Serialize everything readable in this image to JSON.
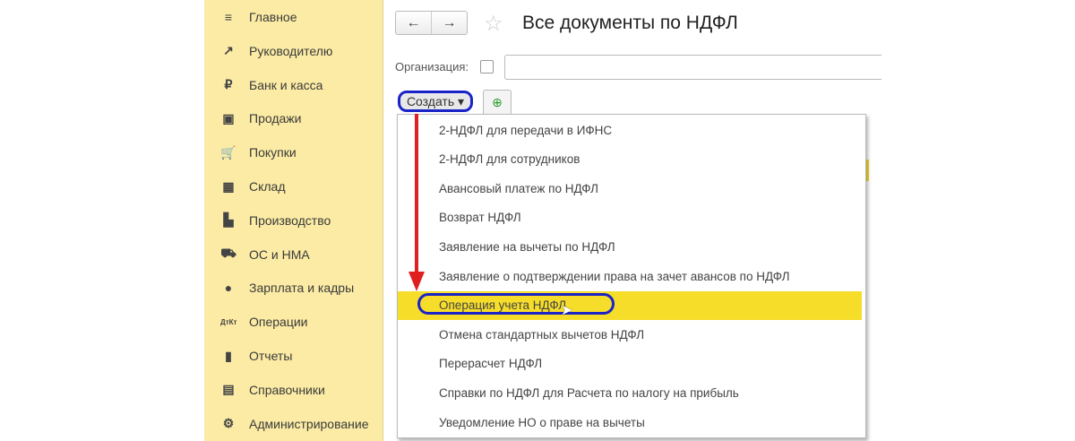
{
  "sidebar": {
    "items": [
      {
        "label": "Главное",
        "icon": "≡"
      },
      {
        "label": "Руководителю",
        "icon": "↗"
      },
      {
        "label": "Банк и касса",
        "icon": "₽"
      },
      {
        "label": "Продажи",
        "icon": "▣"
      },
      {
        "label": "Покупки",
        "icon": "🛒"
      },
      {
        "label": "Склад",
        "icon": "▦"
      },
      {
        "label": "Производство",
        "icon": "▙"
      },
      {
        "label": "ОС и НМА",
        "icon": "⛟"
      },
      {
        "label": "Зарплата и кадры",
        "icon": "●"
      },
      {
        "label": "Операции",
        "icon": "ДтКт"
      },
      {
        "label": "Отчеты",
        "icon": "▮"
      },
      {
        "label": "Справочники",
        "icon": "▤"
      },
      {
        "label": "Администрирование",
        "icon": "⚙"
      }
    ]
  },
  "header": {
    "back": "←",
    "forward": "→",
    "star": "☆",
    "title": "Все документы по НДФЛ"
  },
  "filter": {
    "org_label": "Организация:"
  },
  "toolbar": {
    "create_label": "Создать ▾",
    "add_icon": "⊕"
  },
  "menu": {
    "items": [
      "2-НДФЛ для передачи в ИФНС",
      "2-НДФЛ для сотрудников",
      "Авансовый платеж по НДФЛ",
      "Возврат НДФЛ",
      "Заявление на вычеты по НДФЛ",
      "Заявление о подтверждении права на зачет авансов по НДФЛ",
      "Операция учета НДФЛ",
      "Отмена стандартных вычетов НДФЛ",
      "Перерасчет НДФЛ",
      "Справки по НДФЛ для Расчета по налогу на прибыль",
      "Уведомление НО о праве на вычеты"
    ],
    "selected_index": 6
  },
  "colors": {
    "sidebar": "#fbeba4",
    "highlight": "#f6dd2a",
    "annotation": "#1a23c8",
    "arrow": "#e02020"
  }
}
